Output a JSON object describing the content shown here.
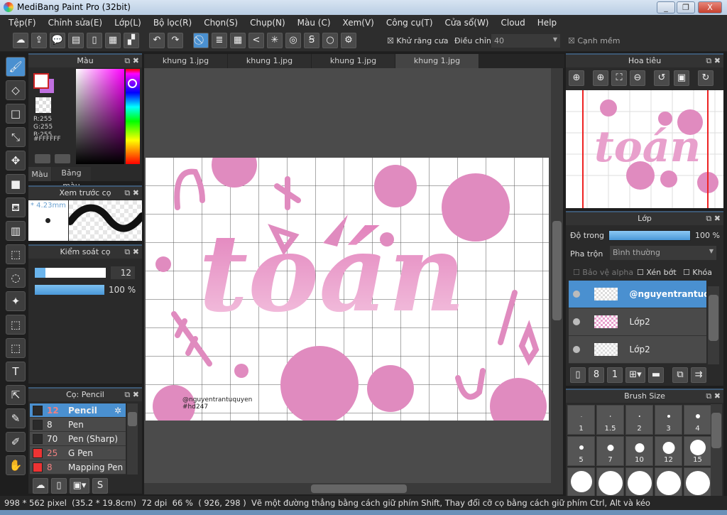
{
  "window": {
    "title": "MediBang Paint Pro (32bit)",
    "minimize": "_",
    "restore": "❐",
    "close": "X"
  },
  "menu": [
    "Tệp(F)",
    "Chỉnh sửa(E)",
    "Lớp(L)",
    "Bộ lọc(R)",
    "Chọn(S)",
    "Chụp(N)",
    "Màu (C)",
    "Xem(V)",
    "Công cụ(T)",
    "Cửa sổ(W)",
    "Cloud",
    "Help"
  ],
  "toolbar": {
    "antialias_label": "Khử răng cưa",
    "antialias_checked": true,
    "correction_label": "Điều chỉnh",
    "correction_value": "40",
    "soft_edge_label": "Cạnh mềm",
    "soft_edge_checked": true
  },
  "tabs": [
    "khung 1.jpg",
    "khung 1.jpg",
    "khung 1.jpg",
    "khung 1.jpg"
  ],
  "active_tab": 3,
  "color_panel": {
    "title": "Màu",
    "r": "R:255",
    "g": "G:255",
    "b": "B:255",
    "hex": "#FFFFFF",
    "primary": "#FFFFFF",
    "secondary": "#C070E0",
    "tabs": [
      "Màu",
      "Bảng màu"
    ]
  },
  "brush_preview": {
    "title": "Xem trước cọ",
    "size": "* 4.23mm"
  },
  "brush_control": {
    "title": "Kiểm soát cọ",
    "size_value": "12",
    "size_fraction": 0.15,
    "opacity_value": "100 %",
    "opacity_fraction": 1.0
  },
  "brush_list": {
    "title": "Cọ: Pencil",
    "items": [
      {
        "size": "12",
        "name": "Pencil",
        "color": "#2a2a2a",
        "selected": true
      },
      {
        "size": "8",
        "name": "Pen",
        "color": "#2a2a2a"
      },
      {
        "size": "70",
        "name": "Pen (Sharp)",
        "color": "#2a2a2a"
      },
      {
        "size": "25",
        "name": "G Pen",
        "color": "#ee3333"
      },
      {
        "size": "8",
        "name": "Mapping Pen",
        "color": "#ee3333"
      }
    ]
  },
  "navigator": {
    "title": "Hoa tiêu"
  },
  "layers": {
    "title": "Lớp",
    "opacity_label": "Độ trong",
    "opacity_value": "100 %",
    "blend_label": "Pha trộn",
    "blend_value": "Bình thường",
    "protect_alpha": "Bảo vệ alpha",
    "clipping": "Xén bớt",
    "lock": "Khóa",
    "items": [
      {
        "name": "@nguyentrantuquyen",
        "selected": true
      },
      {
        "name": "Lớp2"
      },
      {
        "name": "Lớp2"
      }
    ]
  },
  "brush_size": {
    "title": "Brush Size",
    "sizes": [
      "1",
      "1.5",
      "2",
      "3",
      "4",
      "5",
      "7",
      "10",
      "12",
      "15",
      "",
      "",
      "",
      "",
      ""
    ]
  },
  "artwork": {
    "text": "toán",
    "watermark": "@nguyentrantuquyen",
    "tag": "#hd247",
    "pink": "#E08BBF"
  },
  "status": {
    "dims": "998 * 562 pixel",
    "cm": "(35.2 * 19.8cm)",
    "dpi": "72 dpi",
    "zoom": "66 %",
    "coords": "( 926, 298 )",
    "hint": "Vẽ một đường thẳng bằng cách giữ phím Shift, Thay đổi cỡ cọ bằng cách giữ phím Ctrl, Alt và kéo"
  }
}
